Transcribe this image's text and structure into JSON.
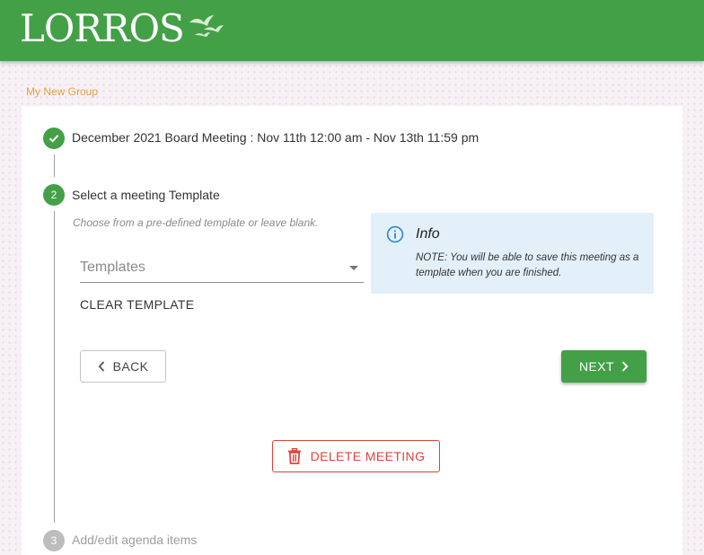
{
  "header": {
    "logo_text": "LORROS",
    "icon": "birds-logo-icon",
    "color": "#43a047"
  },
  "breadcrumb": {
    "group": "My New Group"
  },
  "steps": [
    {
      "status": "completed",
      "icon": "check-icon",
      "text": "December 2021 Board Meeting : Nov 11th 12:00 am - Nov 13th 11:59 pm"
    },
    {
      "status": "active",
      "number": "2",
      "text": "Select a meeting Template",
      "hint": "Choose from a pre-defined template or leave blank.",
      "select": {
        "placeholder": "Templates",
        "icon": "caret-down-icon"
      },
      "clear_label": "CLEAR TEMPLATE",
      "info": {
        "icon": "info-icon",
        "title": "Info",
        "note": "NOTE: You will be able to save this meeting as a template when you are finished."
      },
      "back_label": "BACK",
      "next_label": "NEXT",
      "delete_label": "DELETE MEETING"
    },
    {
      "status": "upcoming",
      "number": "3",
      "text": "Add/edit agenda items"
    }
  ],
  "colors": {
    "primary": "#43a047",
    "accent": "#e6a13c",
    "danger": "#d9453b",
    "info_bg": "#e3f0fa",
    "info_icon": "#2f86cf"
  }
}
